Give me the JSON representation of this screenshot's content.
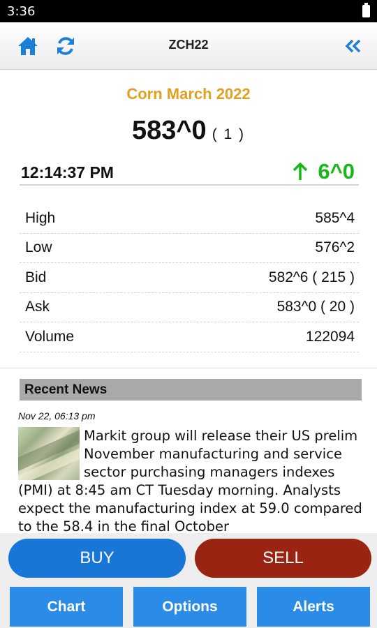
{
  "status_bar": {
    "time": "3:36"
  },
  "header": {
    "symbol": "ZCH22",
    "home_icon": "home-icon",
    "refresh_icon": "refresh-icon",
    "back_icon": "double-chevron-left-icon",
    "accent": "#1a7fd6"
  },
  "quote": {
    "name": "Corn March 2022",
    "last": "583^0",
    "last_size": "( 1 )",
    "time": "12:14:37 PM",
    "change": "6^0",
    "change_direction_icon": "arrow-up-icon",
    "change_color": "#16b816",
    "name_color": "#e0a020"
  },
  "stats": [
    {
      "label": "High",
      "value": "585^4"
    },
    {
      "label": "Low",
      "value": "576^2"
    },
    {
      "label": "Bid",
      "value": "582^6 ( 215 )"
    },
    {
      "label": "Ask",
      "value": "583^0 ( 20 )"
    },
    {
      "label": "Volume",
      "value": "122094"
    }
  ],
  "news": {
    "header": "Recent News",
    "date": "Nov 22, 06:13 pm",
    "thumbnail_icon": "money-photo",
    "text": "Markit group will release their US prelim November manufacturing and service sector purchasing managers indexes (PMI) at 8:45 am CT Tuesday morning. Analysts expect the manufacturing index at 59.0 compared to the 58.4 in the final October"
  },
  "actions": {
    "buy": "BUY",
    "sell": "SELL",
    "buy_color": "#1877d6",
    "sell_color": "#9a2412"
  },
  "tabs": [
    {
      "label": "Chart"
    },
    {
      "label": "Options"
    },
    {
      "label": "Alerts"
    }
  ]
}
